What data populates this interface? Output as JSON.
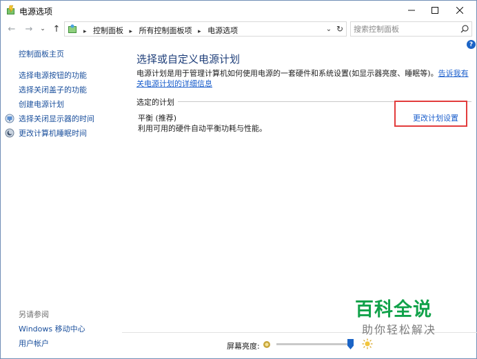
{
  "window": {
    "title": "电源选项"
  },
  "nav": {
    "breadcrumbs": [
      "控制面板",
      "所有控制面板项",
      "电源选项"
    ],
    "search_placeholder": "搜索控制面板"
  },
  "left_pane": {
    "home": "控制面板主页",
    "tasks": [
      {
        "label": "选择电源按钮的功能",
        "icon": null
      },
      {
        "label": "选择关闭盖子的功能",
        "icon": null
      },
      {
        "label": "创建电源计划",
        "icon": null
      },
      {
        "label": "选择关闭显示器的时间",
        "icon": "monitor-icon"
      },
      {
        "label": "更改计算机睡眠时间",
        "icon": "moon-icon"
      }
    ],
    "see_also_label": "另请参阅",
    "see_also": [
      "Windows 移动中心",
      "用户帐户"
    ]
  },
  "main": {
    "title": "选择或自定义电源计划",
    "description": "电源计划是用于管理计算机如何使用电源的一套硬件和系统设置(如显示器亮度、睡眠等)。",
    "learn_more": "告诉我有关电源计划的详细信息",
    "section_label": "选定的计划",
    "plan": {
      "name": "平衡 (推荐)",
      "description": "利用可用的硬件自动平衡功耗与性能。",
      "change_link": "更改计划设置"
    }
  },
  "bottom": {
    "brightness_label": "屏幕亮度:",
    "brightness_value": 0.96
  },
  "watermark": {
    "title": "百科全说",
    "subtitle": "助你轻松解决"
  },
  "colors": {
    "link": "#1a5ecc",
    "title": "#1f3f7a",
    "highlight": "#e23b3b",
    "watermark": "#11a24a"
  }
}
